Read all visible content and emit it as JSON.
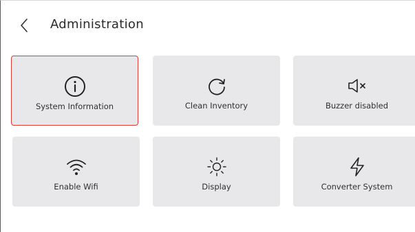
{
  "header": {
    "title": "Administration",
    "back_icon": "chevron-left-icon"
  },
  "tiles": [
    {
      "label": "System Information",
      "icon": "info-circle-icon",
      "selected": true
    },
    {
      "label": "Clean Inventory",
      "icon": "refresh-icon",
      "selected": false
    },
    {
      "label": "Buzzer disabled",
      "icon": "speaker-muted-icon",
      "selected": false
    },
    {
      "label": "Enable Wifi",
      "icon": "wifi-icon",
      "selected": false
    },
    {
      "label": "Display",
      "icon": "sun-icon",
      "selected": false
    },
    {
      "label": "Converter System",
      "icon": "lightning-icon",
      "selected": false
    }
  ],
  "colors": {
    "tile_background": "#e8e8ea",
    "selection_border": "#e53935",
    "text": "#2f2f2f"
  }
}
